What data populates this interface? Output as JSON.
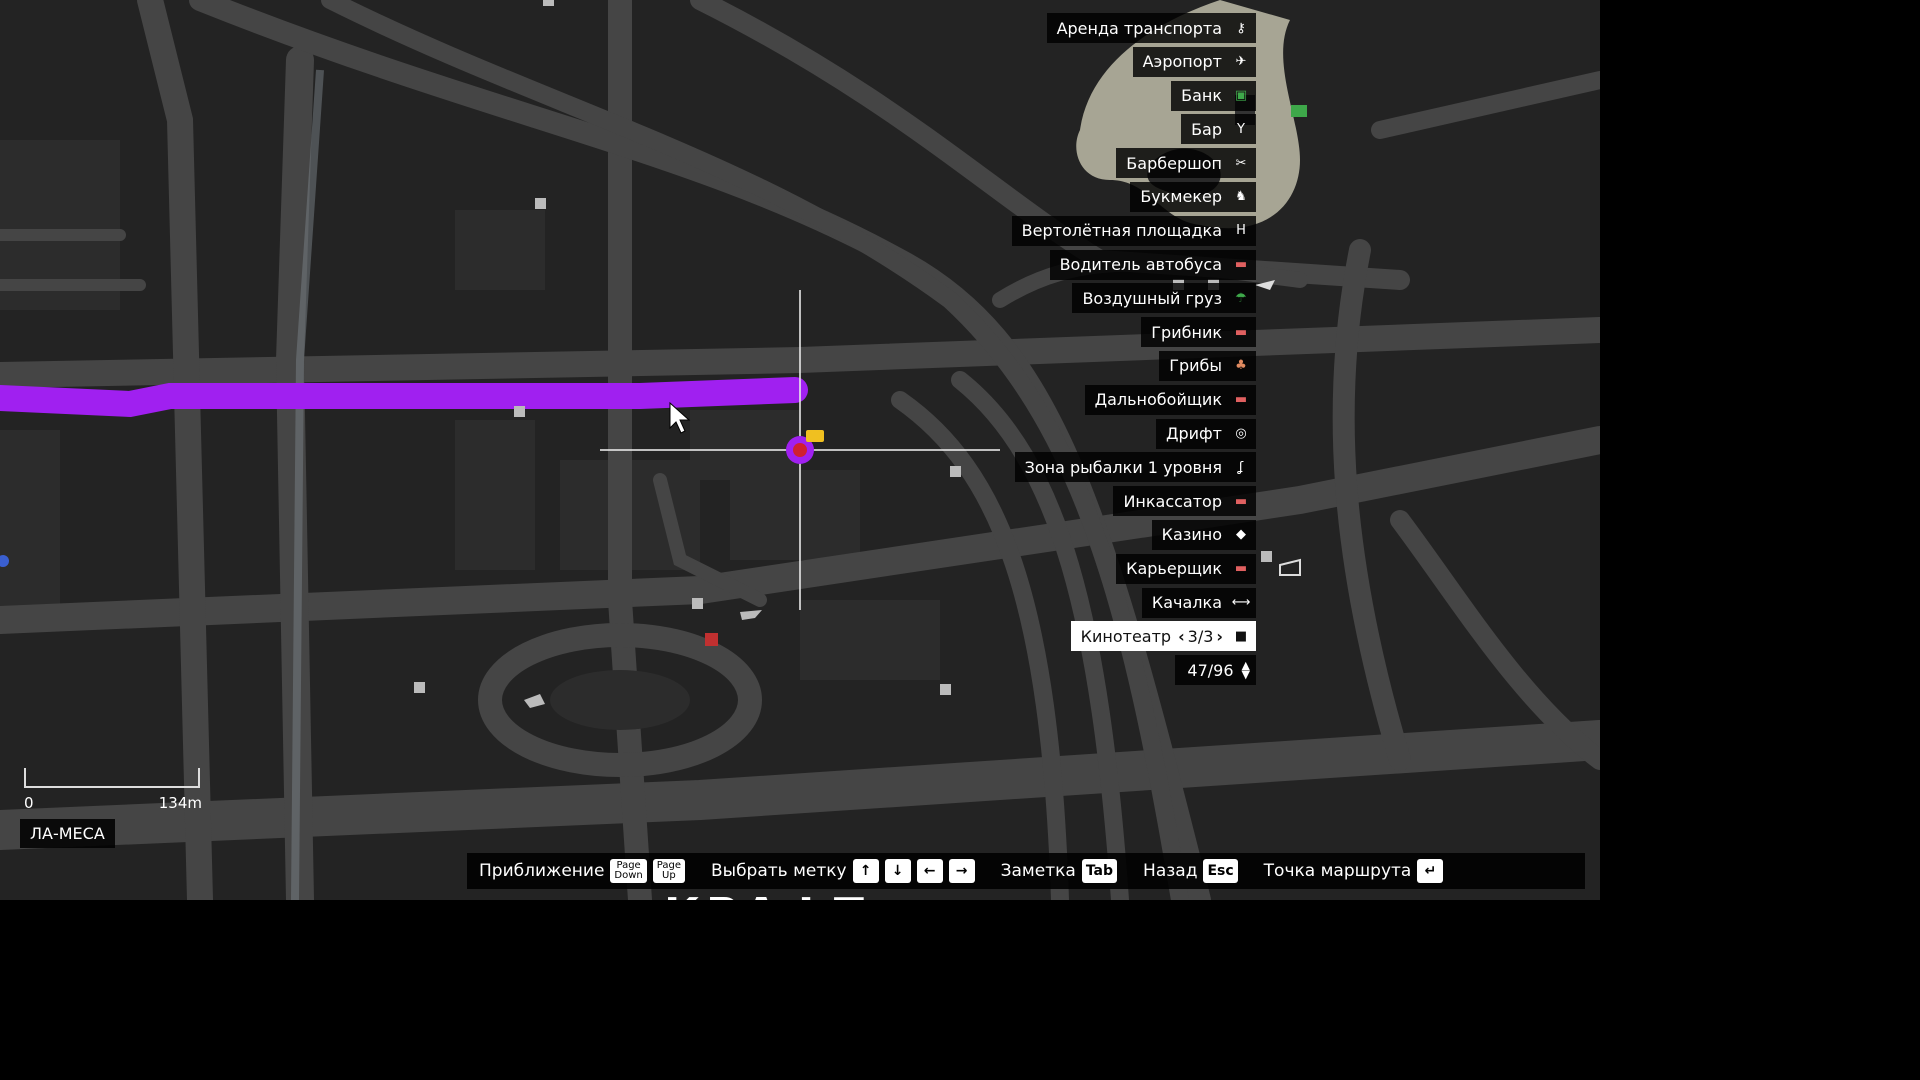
{
  "legend": {
    "items": [
      {
        "label": "Аренда транспорта",
        "icon": "car-key-icon",
        "glyph": "⚷"
      },
      {
        "label": "Аэропорт",
        "icon": "airplane-icon",
        "glyph": "✈"
      },
      {
        "label": "Банк",
        "icon": "money-icon",
        "glyph": "▣",
        "color": "#3ea84a"
      },
      {
        "label": "Бар",
        "icon": "cocktail-glass-icon",
        "glyph": "Y"
      },
      {
        "label": "Барбершоп",
        "icon": "scissors-icon",
        "glyph": "✂"
      },
      {
        "label": "Букмекер",
        "icon": "horse-icon",
        "glyph": "♞"
      },
      {
        "label": "Вертолётная площадка",
        "icon": "helipad-icon",
        "glyph": "H"
      },
      {
        "label": "Водитель автобуса",
        "icon": "job-marker-icon",
        "glyph": "▬",
        "color": "#e06060"
      },
      {
        "label": "Воздушный груз",
        "icon": "parachute-icon",
        "glyph": "☂",
        "color": "#3ea84a"
      },
      {
        "label": "Грибник",
        "icon": "job-marker-icon",
        "glyph": "▬",
        "color": "#e06060"
      },
      {
        "label": "Грибы",
        "icon": "mushroom-icon",
        "glyph": "♣",
        "color": "#e08a60"
      },
      {
        "label": "Дальнобойщик",
        "icon": "job-marker-icon",
        "glyph": "▬",
        "color": "#e06060"
      },
      {
        "label": "Дрифт",
        "icon": "drift-wheel-icon",
        "glyph": "◎"
      },
      {
        "label": "Зона рыбалки 1 уровня",
        "icon": "fishing-hook-icon",
        "glyph": "ʆ"
      },
      {
        "label": "Инкассатор",
        "icon": "job-marker-icon",
        "glyph": "▬",
        "color": "#e06060"
      },
      {
        "label": "Казино",
        "icon": "diamond-icon",
        "glyph": "◆"
      },
      {
        "label": "Карьерщик",
        "icon": "job-marker-icon",
        "glyph": "▬",
        "color": "#e06060"
      },
      {
        "label": "Качалка",
        "icon": "dumbbell-icon",
        "glyph": "⟷"
      }
    ],
    "selected": {
      "label": "Кинотеатр",
      "page": "3/3",
      "icon": "camera-icon",
      "glyph": "■"
    },
    "count": "47/96"
  },
  "scale": {
    "start": "0",
    "end": "134m"
  },
  "zone": "ЛА-МЕСА",
  "controls": [
    {
      "label": "Приближение",
      "keys": [
        {
          "text": [
            "Page",
            "Down"
          ]
        },
        {
          "text": [
            "Page",
            "Up"
          ]
        }
      ]
    },
    {
      "label": "Выбрать метку",
      "keys": [
        {
          "text": [
            "↑"
          ]
        },
        {
          "text": [
            "↓"
          ]
        },
        {
          "text": [
            "←"
          ]
        },
        {
          "text": [
            "→"
          ]
        }
      ]
    },
    {
      "label": "Заметка",
      "keys": [
        {
          "text": [
            "Tab"
          ]
        }
      ]
    },
    {
      "label": "Назад",
      "keys": [
        {
          "text": [
            "Esc"
          ]
        }
      ]
    },
    {
      "label": "Точка маршрута",
      "keys": [
        {
          "text": [
            "↵"
          ]
        }
      ]
    }
  ],
  "bottom_text": "КРАФТ",
  "colors": {
    "route": "#a020f0",
    "water": "#a7a594",
    "road": "#454545",
    "land": "#232323"
  }
}
